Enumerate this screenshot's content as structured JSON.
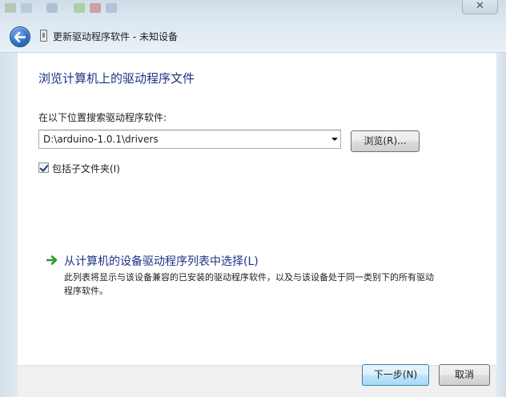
{
  "window": {
    "title": "更新驱动程序软件 - 未知设备",
    "close_label": "✕"
  },
  "main": {
    "heading": "浏览计算机上的驱动程序文件",
    "search_label": "在以下位置搜索驱动程序软件:",
    "path_value": "D:\\arduino-1.0.1\\drivers",
    "browse_label": "浏览(R)...",
    "include_subfolders_label": "包括子文件夹(I)",
    "include_subfolders_checked": true,
    "pick_list_title": "从计算机的设备驱动程序列表中选择(L)",
    "pick_list_description": "此列表将显示与该设备兼容的已安装的驱动程序软件，以及与该设备处于同一类别下的所有驱动程序软件。"
  },
  "footer": {
    "next_label": "下一步(N)",
    "cancel_label": "取消"
  },
  "colors": {
    "heading_blue": "#1e3287",
    "link_arrow_green": "#2e9b2e",
    "back_button_blue": "#2f6fc4"
  },
  "icons": {
    "back": "back-arrow-icon",
    "device": "device-icon",
    "close": "close-icon",
    "link": "green-arrow-icon",
    "dropdown": "chevron-down-icon"
  }
}
